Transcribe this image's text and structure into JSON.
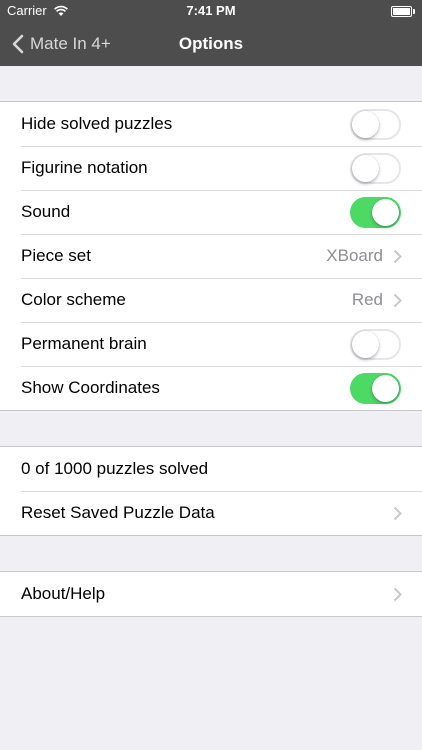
{
  "status_bar": {
    "carrier": "Carrier",
    "time": "7:41 PM"
  },
  "nav": {
    "back_label": "Mate In 4+",
    "title": "Options"
  },
  "settings": {
    "hide_solved": {
      "label": "Hide solved puzzles",
      "on": false
    },
    "figurine_notation": {
      "label": "Figurine notation",
      "on": false
    },
    "sound": {
      "label": "Sound",
      "on": true
    },
    "piece_set": {
      "label": "Piece set",
      "value": "XBoard"
    },
    "color_scheme": {
      "label": "Color scheme",
      "value": "Red"
    },
    "permanent_brain": {
      "label": "Permanent brain",
      "on": false
    },
    "show_coordinates": {
      "label": "Show Coordinates",
      "on": true
    }
  },
  "progress": {
    "solved_text": "0 of 1000 puzzles solved",
    "reset_label": "Reset Saved Puzzle Data"
  },
  "about": {
    "label": "About/Help"
  },
  "colors": {
    "toolbar": "#4d4d4d",
    "toggle_on": "#4cd964",
    "background": "#efeff4"
  }
}
